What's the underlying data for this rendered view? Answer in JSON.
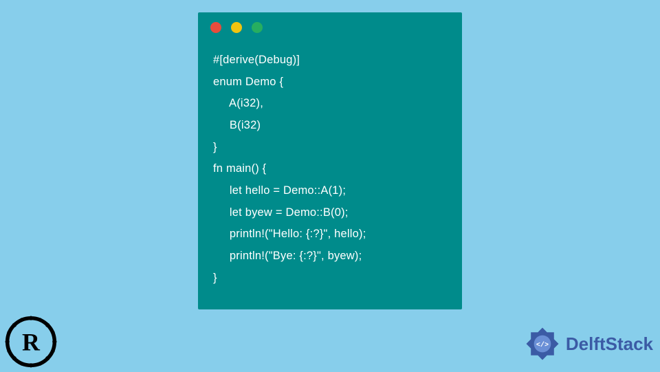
{
  "window": {
    "dots": [
      "red",
      "yellow",
      "green"
    ]
  },
  "code": {
    "lines": [
      "#[derive(Debug)]",
      "enum Demo {",
      "     A(i32),",
      "     B(i32)",
      "}",
      "fn main() {",
      "     let hello = Demo::A(1);",
      "     let byew = Demo::B(0);",
      "     println!(\"Hello: {:?}\", hello);",
      "     println!(\"Bye: {:?}\", byew);",
      "}"
    ]
  },
  "branding": {
    "rust_logo_alt": "Rust logo",
    "delft_name": "DelftStack"
  }
}
